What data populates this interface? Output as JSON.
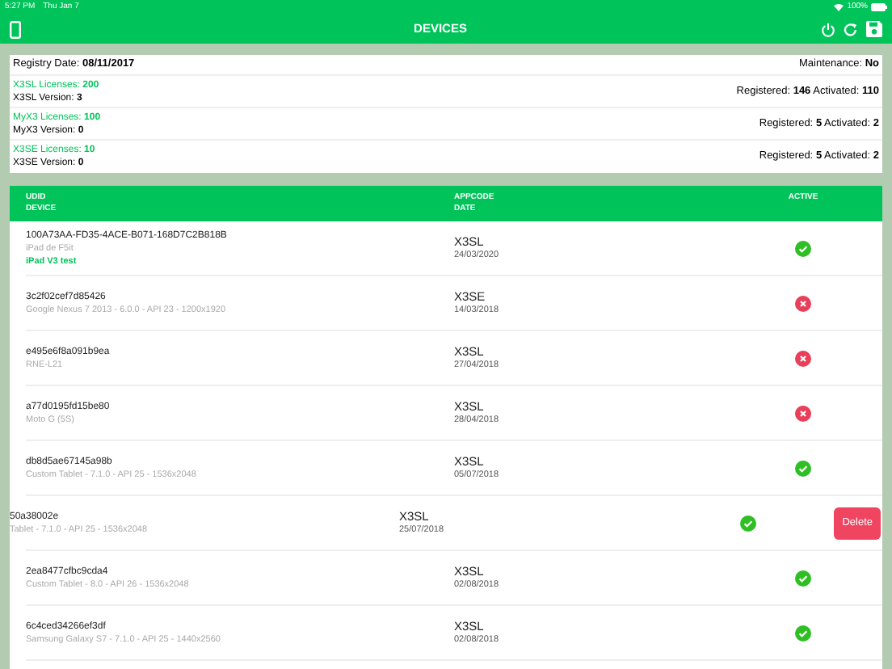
{
  "status_bar": {
    "time": "5:27 PM",
    "date": "Thu Jan 7",
    "battery": "100%"
  },
  "nav": {
    "title": "DEVICES"
  },
  "summary": {
    "registry_label": "Registry Date:",
    "registry_date": "08/11/2017",
    "maintenance_label": "Maintenance:",
    "maintenance": "No",
    "licenses": [
      {
        "licenses_label": "X3SL Licenses:",
        "licenses": "200",
        "version_label": "X3SL Version:",
        "version": "3",
        "registered_label": "Registered:",
        "registered": "146",
        "activated_label": "Activated:",
        "activated": "110"
      },
      {
        "licenses_label": "MyX3 Licenses:",
        "licenses": "100",
        "version_label": "MyX3 Version:",
        "version": "0",
        "registered_label": "Registered:",
        "registered": "5",
        "activated_label": "Activated:",
        "activated": "2"
      },
      {
        "licenses_label": "X3SE Licenses:",
        "licenses": "10",
        "version_label": "X3SE Version:",
        "version": "0",
        "registered_label": "Registered:",
        "registered": "5",
        "activated_label": "Activated:",
        "activated": "2"
      }
    ]
  },
  "table": {
    "columns": [
      {
        "line1": "UDID",
        "line2": "DEVICE"
      },
      {
        "line1": "APPCODE",
        "line2": "DATE"
      },
      {
        "line1": "ACTIVE"
      }
    ],
    "delete_label": "Delete",
    "rows": [
      {
        "udid": "100A73AA-FD35-4ACE-B071-168D7C2B818B",
        "device": "iPad de F5it",
        "note": "iPad V3 test",
        "appcode": "X3SL",
        "date": "24/03/2020",
        "active": true,
        "swiped": false
      },
      {
        "udid": "3c2f02cef7d85426",
        "device": "Google Nexus 7 2013 - 6.0.0 - API 23 - 1200x1920",
        "appcode": "X3SE",
        "date": "14/03/2018",
        "active": false,
        "swiped": false
      },
      {
        "udid": "e495e6f8a091b9ea",
        "device": "RNE-L21",
        "appcode": "X3SL",
        "date": "27/04/2018",
        "active": false,
        "swiped": false
      },
      {
        "udid": "a77d0195fd15be80",
        "device": "Moto G (5S)",
        "appcode": "X3SL",
        "date": "28/04/2018",
        "active": false,
        "swiped": false
      },
      {
        "udid": "db8d5ae67145a98b",
        "device": "Custom Tablet - 7.1.0 - API 25 - 1536x2048",
        "appcode": "X3SL",
        "date": "05/07/2018",
        "active": true,
        "swiped": false
      },
      {
        "udid": "50a38002e",
        "device": "Tablet - 7.1.0 - API 25 - 1536x2048",
        "appcode": "X3SL",
        "date": "25/07/2018",
        "active": true,
        "swiped": true
      },
      {
        "udid": "2ea8477cfbc9cda4",
        "device": "Custom Tablet - 8.0 - API 26 - 1536x2048",
        "appcode": "X3SL",
        "date": "02/08/2018",
        "active": true,
        "swiped": false
      },
      {
        "udid": "6c4ced34266ef3df",
        "device": "Samsung Galaxy S7 - 7.1.0 - API 25 - 1440x2560",
        "appcode": "X3SL",
        "date": "02/08/2018",
        "active": true,
        "swiped": false
      }
    ]
  }
}
